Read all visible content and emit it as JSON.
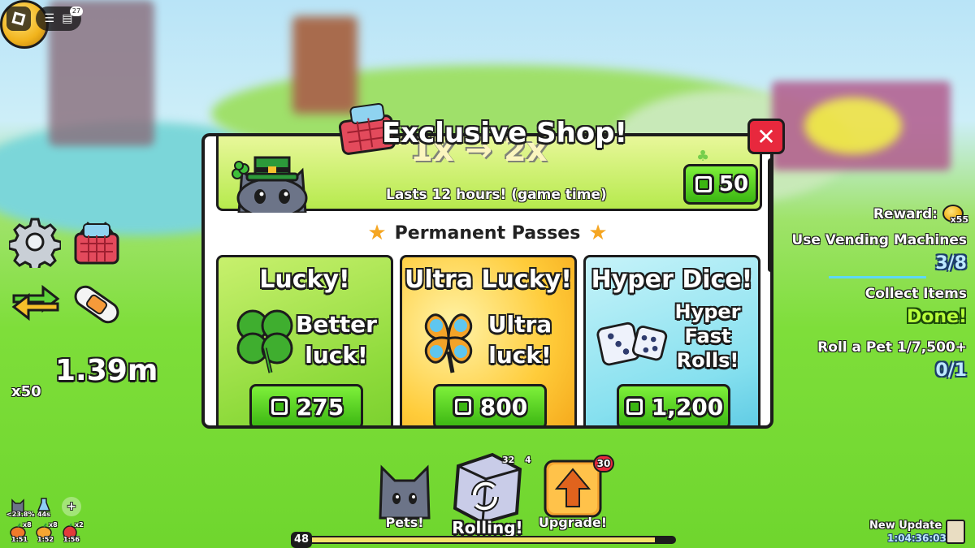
{
  "topbar": {
    "notification_count": "27"
  },
  "currency": {
    "amount": "1.39m",
    "multiplier": "x50"
  },
  "shop": {
    "title": "Exclusive Shop!",
    "boost": {
      "big_text": "1x → 2x",
      "duration": "Lasts 12 hours! (game time)",
      "price": "50"
    },
    "section_title": "Permanent Passes",
    "passes": [
      {
        "title": "Lucky!",
        "desc_line1": "Better",
        "desc_line2": "luck!",
        "price": "275"
      },
      {
        "title": "Ultra Lucky!",
        "desc_line1": "Ultra",
        "desc_line2": "luck!",
        "price": "800"
      },
      {
        "title": "Hyper Dice!",
        "desc_line1": "Hyper",
        "desc_line2": "Fast",
        "desc_line3": "Rolls!",
        "price": "1,200"
      }
    ]
  },
  "quests": {
    "reward_label": "Reward:",
    "reward_multiplier": "x55",
    "items": [
      {
        "name": "Use Vending Machines",
        "progress": "3/8"
      },
      {
        "name": "Collect Items",
        "progress": "Done!"
      },
      {
        "name": "Roll a Pet 1/7,500+",
        "progress": "0/1"
      }
    ]
  },
  "bottom": {
    "pets_label": "Pets!",
    "rolling_label": "Rolling!",
    "upgrade_label": "Upgrade!",
    "upgrade_badge": "30",
    "roll_count_a": "32",
    "roll_count_b": "4",
    "level": "48",
    "xp_progress_pct": 95
  },
  "buffs": [
    {
      "label": "<23.8%"
    },
    {
      "label": "44s"
    },
    {
      "label": "1:51",
      "count": "x8"
    },
    {
      "label": "1:52",
      "count": "x8"
    },
    {
      "label": "1:56",
      "count": "x2"
    }
  ],
  "update": {
    "label": "New Update",
    "timer": "1:04:36:03"
  },
  "colors": {
    "accent_green": "#3bb612",
    "close_red": "#e8283d",
    "outline": "#1c1c1c"
  }
}
